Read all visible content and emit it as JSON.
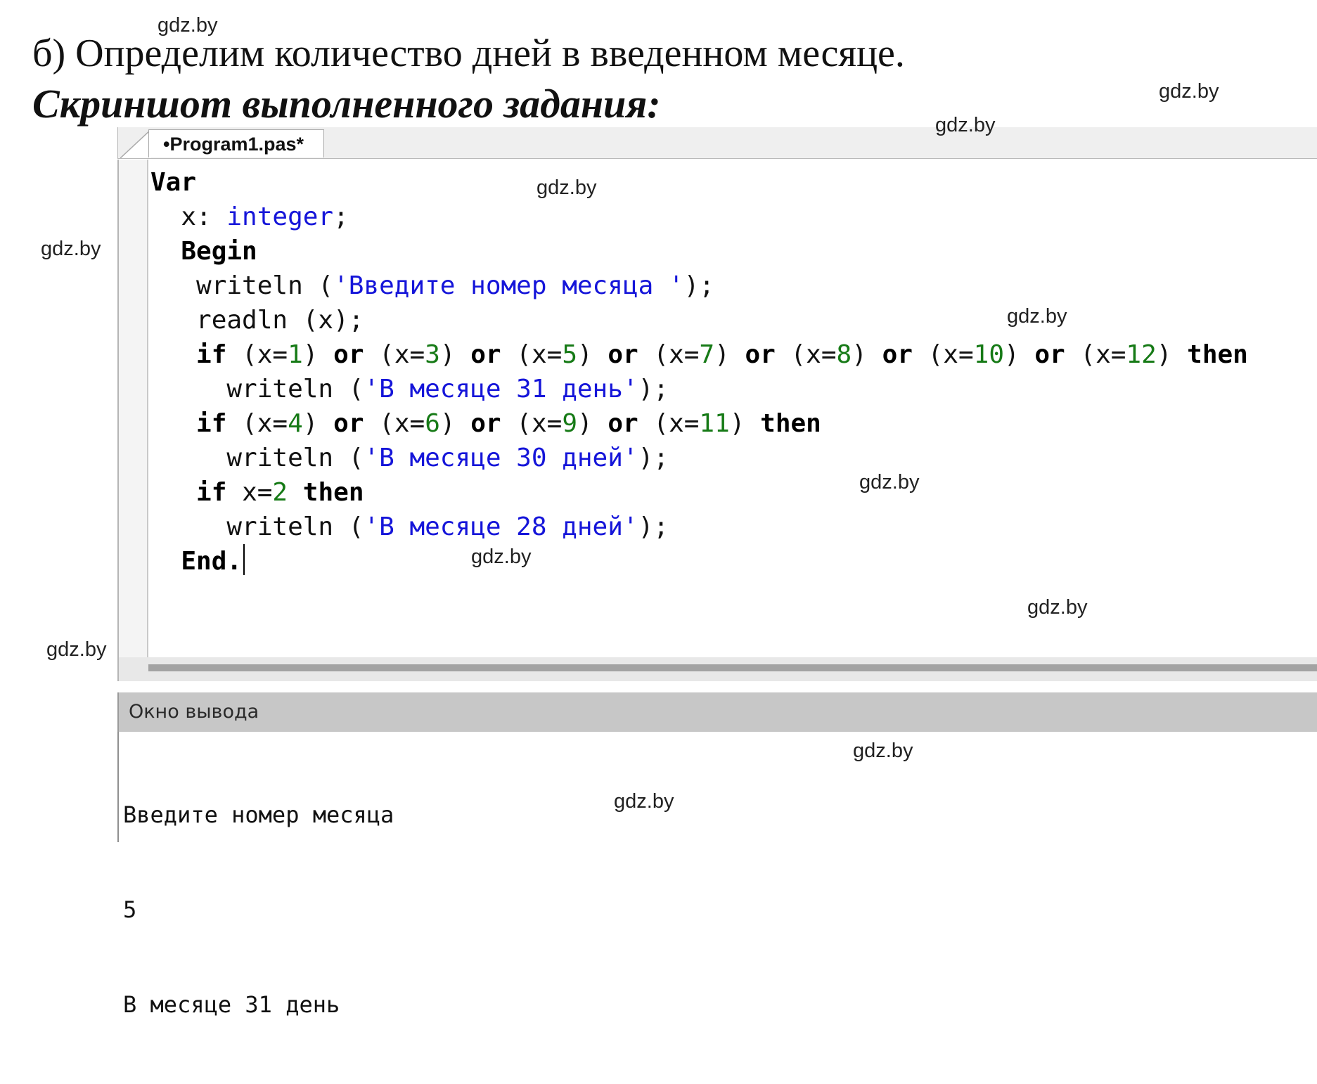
{
  "task": {
    "text": "б) Определим количество дней в введенном месяце.",
    "screenshot_heading": "Скриншот выполненного задания:"
  },
  "watermark": "gdz.by",
  "ide": {
    "tab_label": "•Program1.pas*",
    "code_lines": [
      [
        {
          "t": "Var",
          "c": "kw"
        }
      ],
      [
        {
          "t": "  x: ",
          "c": ""
        },
        {
          "t": "integer",
          "c": "ty"
        },
        {
          "t": ";",
          "c": ""
        }
      ],
      [
        {
          "t": "  ",
          "c": ""
        },
        {
          "t": "Begin",
          "c": "kw"
        }
      ],
      [
        {
          "t": "   writeln (",
          "c": ""
        },
        {
          "t": "'Введите номер месяца '",
          "c": "st"
        },
        {
          "t": ");",
          "c": ""
        }
      ],
      [
        {
          "t": "   readln (x);",
          "c": ""
        }
      ],
      [
        {
          "t": "   ",
          "c": ""
        },
        {
          "t": "if",
          "c": "kw"
        },
        {
          "t": " (x=",
          "c": ""
        },
        {
          "t": "1",
          "c": "nu"
        },
        {
          "t": ") ",
          "c": ""
        },
        {
          "t": "or",
          "c": "kw"
        },
        {
          "t": " (x=",
          "c": ""
        },
        {
          "t": "3",
          "c": "nu"
        },
        {
          "t": ") ",
          "c": ""
        },
        {
          "t": "or",
          "c": "kw"
        },
        {
          "t": " (x=",
          "c": ""
        },
        {
          "t": "5",
          "c": "nu"
        },
        {
          "t": ") ",
          "c": ""
        },
        {
          "t": "or",
          "c": "kw"
        },
        {
          "t": " (x=",
          "c": ""
        },
        {
          "t": "7",
          "c": "nu"
        },
        {
          "t": ") ",
          "c": ""
        },
        {
          "t": "or",
          "c": "kw"
        },
        {
          "t": " (x=",
          "c": ""
        },
        {
          "t": "8",
          "c": "nu"
        },
        {
          "t": ") ",
          "c": ""
        },
        {
          "t": "or",
          "c": "kw"
        },
        {
          "t": " (x=",
          "c": ""
        },
        {
          "t": "10",
          "c": "nu"
        },
        {
          "t": ") ",
          "c": ""
        },
        {
          "t": "or",
          "c": "kw"
        },
        {
          "t": " (x=",
          "c": ""
        },
        {
          "t": "12",
          "c": "nu"
        },
        {
          "t": ") ",
          "c": ""
        },
        {
          "t": "then",
          "c": "kw"
        }
      ],
      [
        {
          "t": "     writeln (",
          "c": ""
        },
        {
          "t": "'В месяце 31 день'",
          "c": "st"
        },
        {
          "t": ");",
          "c": ""
        }
      ],
      [
        {
          "t": "   ",
          "c": ""
        },
        {
          "t": "if",
          "c": "kw"
        },
        {
          "t": " (x=",
          "c": ""
        },
        {
          "t": "4",
          "c": "nu"
        },
        {
          "t": ") ",
          "c": ""
        },
        {
          "t": "or",
          "c": "kw"
        },
        {
          "t": " (x=",
          "c": ""
        },
        {
          "t": "6",
          "c": "nu"
        },
        {
          "t": ") ",
          "c": ""
        },
        {
          "t": "or",
          "c": "kw"
        },
        {
          "t": " (x=",
          "c": ""
        },
        {
          "t": "9",
          "c": "nu"
        },
        {
          "t": ") ",
          "c": ""
        },
        {
          "t": "or",
          "c": "kw"
        },
        {
          "t": " (x=",
          "c": ""
        },
        {
          "t": "11",
          "c": "nu"
        },
        {
          "t": ") ",
          "c": ""
        },
        {
          "t": "then",
          "c": "kw"
        }
      ],
      [
        {
          "t": "     writeln (",
          "c": ""
        },
        {
          "t": "'В месяце 30 дней'",
          "c": "st"
        },
        {
          "t": ");",
          "c": ""
        }
      ],
      [
        {
          "t": "   ",
          "c": ""
        },
        {
          "t": "if",
          "c": "kw"
        },
        {
          "t": " x=",
          "c": ""
        },
        {
          "t": "2",
          "c": "nu"
        },
        {
          "t": " ",
          "c": ""
        },
        {
          "t": "then",
          "c": "kw"
        }
      ],
      [
        {
          "t": "     writeln (",
          "c": ""
        },
        {
          "t": "'В месяце 28 дней'",
          "c": "st"
        },
        {
          "t": ");",
          "c": ""
        }
      ],
      [
        {
          "t": "  ",
          "c": ""
        },
        {
          "t": "End.",
          "c": "kw"
        }
      ]
    ],
    "colors": {
      "keyword": "#000000",
      "type_and_string": "#1515d9",
      "number": "#167a16"
    },
    "output_window": {
      "title": "Окно вывода",
      "lines": [
        "Введите номер месяца",
        "5",
        "В месяце 31 день"
      ]
    }
  }
}
